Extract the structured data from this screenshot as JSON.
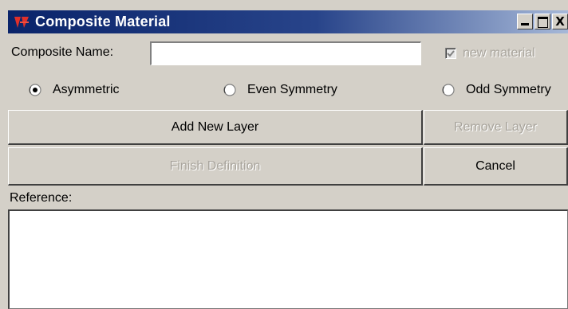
{
  "window": {
    "title": "Composite Material",
    "title_bar_color": "#0a246a",
    "app_icon": "app-logo-icon",
    "controls": {
      "minimize_icon": "minimize-icon",
      "maximize_icon": "maximize-icon",
      "close_icon": "close-icon",
      "close_glyph": "X"
    }
  },
  "name_row": {
    "label": "Composite Name:",
    "value": "",
    "placeholder": "",
    "new_material": {
      "label": "new material",
      "checked": true,
      "disabled": true
    }
  },
  "symmetry": {
    "options": [
      {
        "label": "Asymmetric",
        "selected": true
      },
      {
        "label": "Even Symmetry",
        "selected": false
      },
      {
        "label": "Odd Symmetry",
        "selected": false
      }
    ]
  },
  "buttons": {
    "add_layer": {
      "label": "Add New Layer",
      "enabled": true
    },
    "remove_layer": {
      "label": "Remove Layer",
      "enabled": false
    },
    "finish_definition": {
      "label": "Finish Definition",
      "enabled": false
    },
    "cancel": {
      "label": "Cancel",
      "enabled": true
    }
  },
  "reference": {
    "label": "Reference:",
    "value": ""
  },
  "colors": {
    "dialog_face": "#d4d0c8",
    "disabled_text": "#a8a49c"
  }
}
